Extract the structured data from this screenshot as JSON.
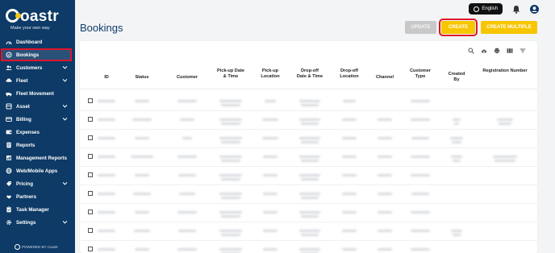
{
  "brand": {
    "name": "oastr",
    "tagline": "Make your own way",
    "powered_by": "POWERED BY Coastr"
  },
  "header": {
    "language_label": "English",
    "title": "Bookings"
  },
  "actions": {
    "update_label": "UPDATE",
    "create_label": "CREATE",
    "create_multiple_label": "CREATE MULTIPLE"
  },
  "sidebar": {
    "items": [
      {
        "label": "Dashboard",
        "icon": "dashboard-icon",
        "chevron": false,
        "active": false
      },
      {
        "label": "Bookings",
        "icon": "bookings-icon",
        "chevron": false,
        "active": true
      },
      {
        "label": "Customers",
        "icon": "customers-icon",
        "chevron": true,
        "active": false
      },
      {
        "label": "Fleet",
        "icon": "fleet-icon",
        "chevron": true,
        "active": false
      },
      {
        "label": "Fleet Movement",
        "icon": "fleet-movement-icon",
        "chevron": false,
        "active": false
      },
      {
        "label": "Asset",
        "icon": "asset-icon",
        "chevron": true,
        "active": false
      },
      {
        "label": "Billing",
        "icon": "billing-icon",
        "chevron": true,
        "active": false
      },
      {
        "label": "Expenses",
        "icon": "expenses-icon",
        "chevron": false,
        "active": false
      },
      {
        "label": "Reports",
        "icon": "reports-icon",
        "chevron": false,
        "active": false
      },
      {
        "label": "Management Reports",
        "icon": "management-reports-icon",
        "chevron": false,
        "active": false
      },
      {
        "label": "Web/Mobile Apps",
        "icon": "apps-icon",
        "chevron": false,
        "active": false
      },
      {
        "label": "Pricing",
        "icon": "pricing-icon",
        "chevron": true,
        "active": false
      },
      {
        "label": "Partners",
        "icon": "partners-icon",
        "chevron": false,
        "active": false
      },
      {
        "label": "Task Manager",
        "icon": "task-manager-icon",
        "chevron": false,
        "active": false
      },
      {
        "label": "Settings",
        "icon": "settings-icon",
        "chevron": true,
        "active": false
      }
    ]
  },
  "table": {
    "columns": [
      "ID",
      "Status",
      "Customer",
      "Pick-up Date & Time",
      "Pick-up Location",
      "Drop-off Date & Time",
      "Drop-off Location",
      "Channel",
      "Customer Type",
      "Created By",
      "Registration Number"
    ]
  },
  "toolbar_icons": [
    "search-icon",
    "cloud-download-icon",
    "print-icon",
    "columns-icon",
    "filter-icon"
  ],
  "colors": {
    "sidebar": "#0d3a66",
    "accent": "#f7c600",
    "highlight": "#e0142c",
    "title": "#0f3d6b"
  }
}
